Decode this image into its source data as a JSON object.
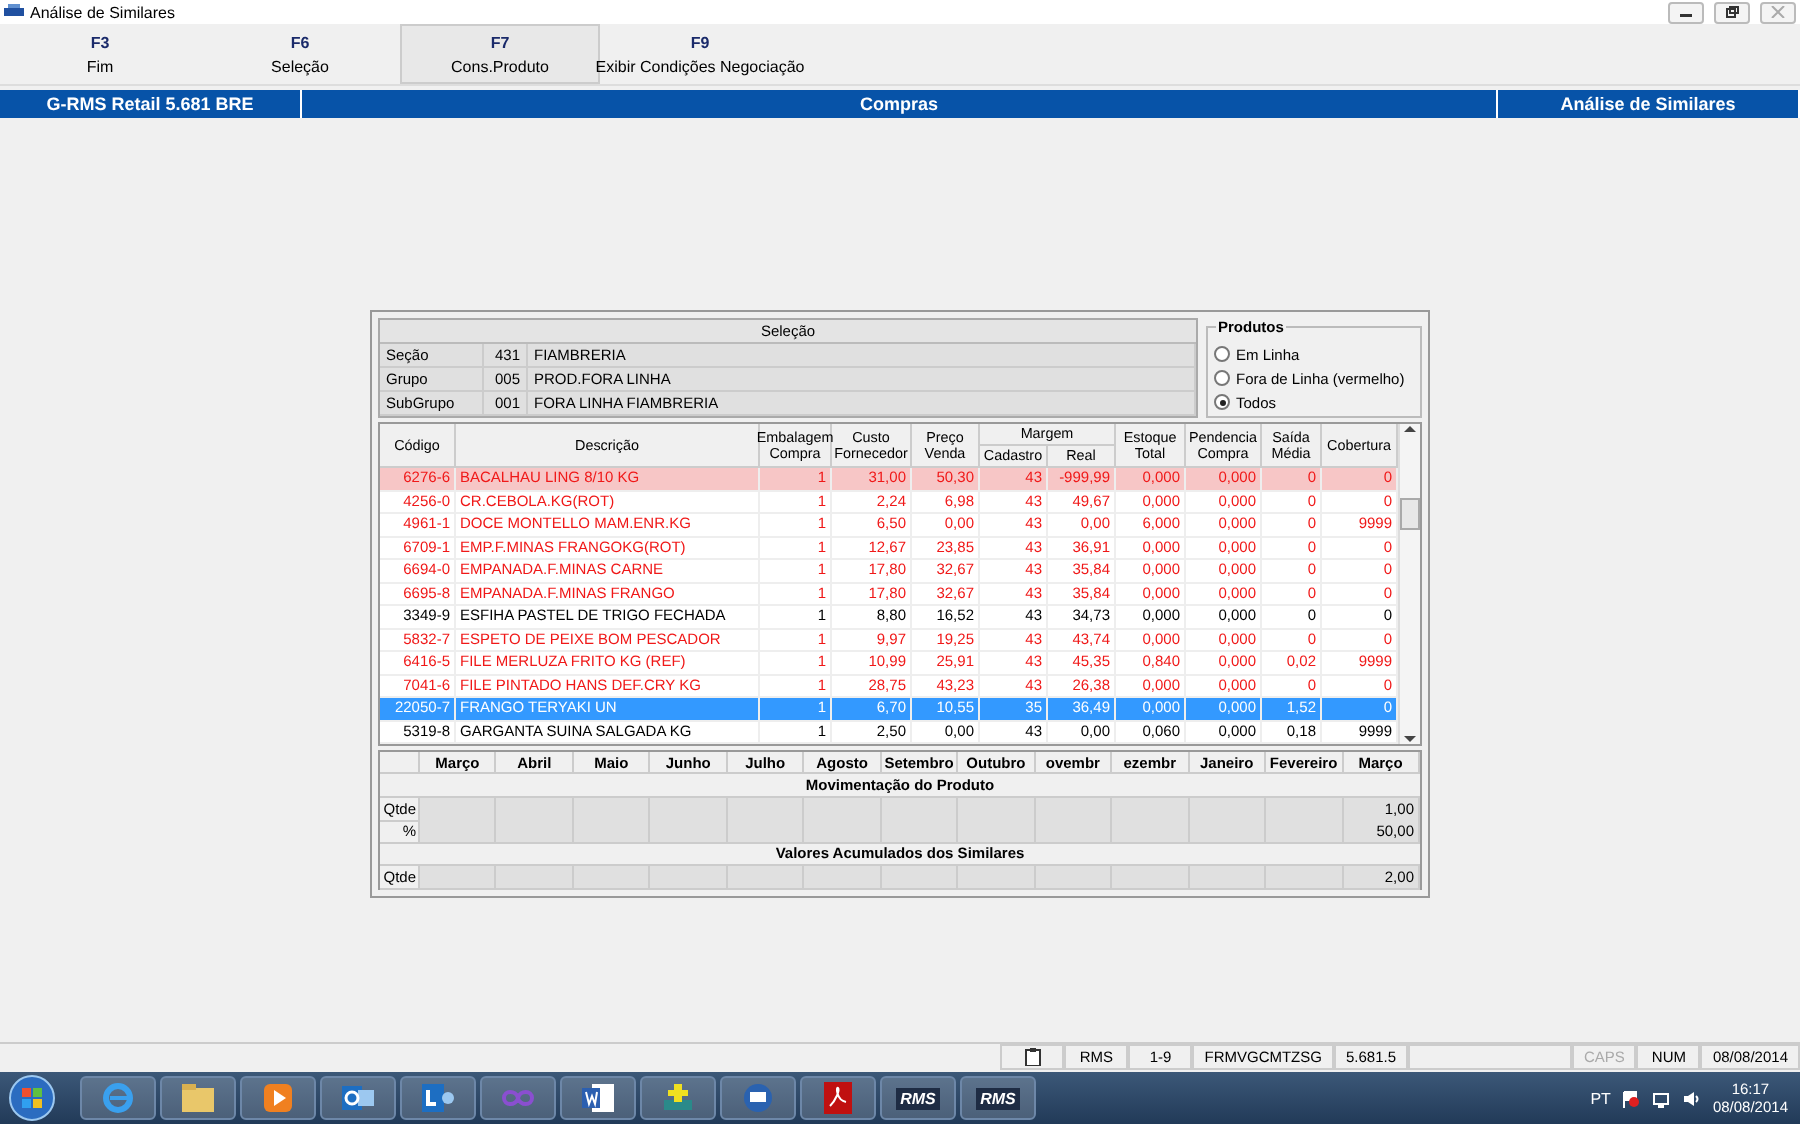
{
  "window": {
    "title": "Análise de Similares"
  },
  "function_keys": [
    {
      "key": "F3",
      "label": "Fim",
      "selected": false
    },
    {
      "key": "F6",
      "label": "Seleção",
      "selected": false
    },
    {
      "key": "F7",
      "label": "Cons.Produto",
      "selected": true
    },
    {
      "key": "F9",
      "label": "Exibir Condições Negociação",
      "selected": false
    }
  ],
  "header": {
    "system": "G-RMS Retail 5.681 BRE",
    "module": "Compras",
    "screen": "Análise de Similares"
  },
  "selection": {
    "title": "Seleção",
    "rows": [
      {
        "label": "Seção",
        "code": "431",
        "name": "FIAMBRERIA"
      },
      {
        "label": "Grupo",
        "code": "005",
        "name": "PROD.FORA LINHA"
      },
      {
        "label": "SubGrupo",
        "code": "001",
        "name": "FORA LINHA FIAMBRERIA"
      }
    ]
  },
  "products_filter": {
    "title": "Produtos",
    "options": [
      {
        "label": "Em Linha",
        "selected": false
      },
      {
        "label": "Fora de Linha (vermelho)",
        "selected": false
      },
      {
        "label": "Todos",
        "selected": true
      }
    ]
  },
  "table": {
    "columns": [
      "Código",
      "Descrição",
      "Embalagem Compra",
      "Custo Fornecedor",
      "Preço Venda",
      {
        "label": "Cadastro",
        "group": "Margem"
      },
      {
        "label": "Real",
        "in_group": true
      },
      "Estoque Total",
      "Pendencia Compra",
      "Saída Média",
      "Cobertura"
    ],
    "rows": [
      {
        "cells": [
          "6276-6",
          "BACALHAU LING 8/10 KG",
          "1",
          "31,00",
          "50,30",
          "43",
          "-999,99",
          "0,000",
          "0,000",
          "0",
          "0"
        ],
        "out_of_line": true,
        "highlighted": true,
        "selected": false
      },
      {
        "cells": [
          "4256-0",
          "CR.CEBOLA.KG(ROT)",
          "1",
          "2,24",
          "6,98",
          "43",
          "49,67",
          "0,000",
          "0,000",
          "0",
          "0"
        ],
        "out_of_line": true,
        "highlighted": false,
        "selected": false
      },
      {
        "cells": [
          "4961-1",
          "DOCE MONTELLO MAM.ENR.KG",
          "1",
          "6,50",
          "0,00",
          "43",
          "0,00",
          "6,000",
          "0,000",
          "0",
          "9999"
        ],
        "out_of_line": true,
        "highlighted": false,
        "selected": false
      },
      {
        "cells": [
          "6709-1",
          "EMP.F.MINAS FRANGOKG(ROT)",
          "1",
          "12,67",
          "23,85",
          "43",
          "36,91",
          "0,000",
          "0,000",
          "0",
          "0"
        ],
        "out_of_line": true,
        "highlighted": false,
        "selected": false
      },
      {
        "cells": [
          "6694-0",
          "EMPANADA.F.MINAS CARNE",
          "1",
          "17,80",
          "32,67",
          "43",
          "35,84",
          "0,000",
          "0,000",
          "0",
          "0"
        ],
        "out_of_line": true,
        "highlighted": false,
        "selected": false
      },
      {
        "cells": [
          "6695-8",
          "EMPANADA.F.MINAS FRANGO",
          "1",
          "17,80",
          "32,67",
          "43",
          "35,84",
          "0,000",
          "0,000",
          "0",
          "0"
        ],
        "out_of_line": true,
        "highlighted": false,
        "selected": false
      },
      {
        "cells": [
          "3349-9",
          "ESFIHA PASTEL DE TRIGO FECHADA",
          "1",
          "8,80",
          "16,52",
          "43",
          "34,73",
          "0,000",
          "0,000",
          "0",
          "0"
        ],
        "out_of_line": false,
        "highlighted": false,
        "selected": false
      },
      {
        "cells": [
          "5832-7",
          "ESPETO DE PEIXE BOM PESCADOR",
          "1",
          "9,97",
          "19,25",
          "43",
          "43,74",
          "0,000",
          "0,000",
          "0",
          "0"
        ],
        "out_of_line": true,
        "highlighted": false,
        "selected": false
      },
      {
        "cells": [
          "6416-5",
          "FILE MERLUZA FRITO KG (REF)",
          "1",
          "10,99",
          "25,91",
          "43",
          "45,35",
          "0,840",
          "0,000",
          "0,02",
          "9999"
        ],
        "out_of_line": true,
        "highlighted": false,
        "selected": false
      },
      {
        "cells": [
          "7041-6",
          "FILE PINTADO HANS DEF.CRY KG",
          "1",
          "28,75",
          "43,23",
          "43",
          "26,38",
          "0,000",
          "0,000",
          "0",
          "0"
        ],
        "out_of_line": true,
        "highlighted": false,
        "selected": false
      },
      {
        "cells": [
          "22050-7",
          "FRANGO TERYAKI UN",
          "1",
          "6,70",
          "10,55",
          "35",
          "36,49",
          "0,000",
          "0,000",
          "1,52",
          "0"
        ],
        "out_of_line": true,
        "highlighted": false,
        "selected": true
      },
      {
        "cells": [
          "5319-8",
          "GARGANTA SUINA SALGADA KG",
          "1",
          "2,50",
          "0,00",
          "43",
          "0,00",
          "0,060",
          "0,000",
          "0,18",
          "9999"
        ],
        "out_of_line": false,
        "highlighted": false,
        "selected": false
      }
    ]
  },
  "months": {
    "columns": [
      "Março",
      "Abril",
      "Maio",
      "Junho",
      "Julho",
      "Agosto",
      "Setembro",
      "Outubro",
      "ovembr",
      "ezembr",
      "Janeiro",
      "Fevereiro",
      "Março"
    ],
    "sections": [
      {
        "title": "Movimentação do Produto",
        "rows": [
          {
            "label": "Qtde",
            "last_value": "1,00"
          },
          {
            "label": "%",
            "last_value": "50,00"
          }
        ]
      },
      {
        "title": "Valores Acumulados dos Similares",
        "rows": [
          {
            "label": "Qtde",
            "last_value": "2,00"
          }
        ]
      }
    ]
  },
  "status_bar": [
    {
      "kind": "icon"
    },
    {
      "kind": "text",
      "text": "RMS"
    },
    {
      "kind": "text",
      "text": "1-9"
    },
    {
      "kind": "text",
      "text": "FRMVGCMTZSG"
    },
    {
      "kind": "text",
      "text": "5.681.5"
    },
    {
      "kind": "blank"
    },
    {
      "kind": "text",
      "text": "CAPS",
      "disabled": true
    },
    {
      "kind": "text",
      "text": "NUM",
      "disabled": false
    },
    {
      "kind": "text",
      "text": "08/08/2014"
    }
  ],
  "taskbar": {
    "apps": [
      {
        "kind": "browser"
      },
      {
        "kind": "folder"
      },
      {
        "kind": "media"
      },
      {
        "kind": "mail"
      },
      {
        "kind": "chat"
      },
      {
        "kind": "infinity"
      },
      {
        "kind": "document"
      },
      {
        "kind": "stack"
      },
      {
        "kind": "remote"
      },
      {
        "kind": "pdf"
      },
      {
        "kind": "rms",
        "label": "RMS"
      },
      {
        "kind": "rms",
        "label": "RMS"
      }
    ],
    "language": "PT",
    "time": "16:17",
    "date": "08/08/2014"
  }
}
